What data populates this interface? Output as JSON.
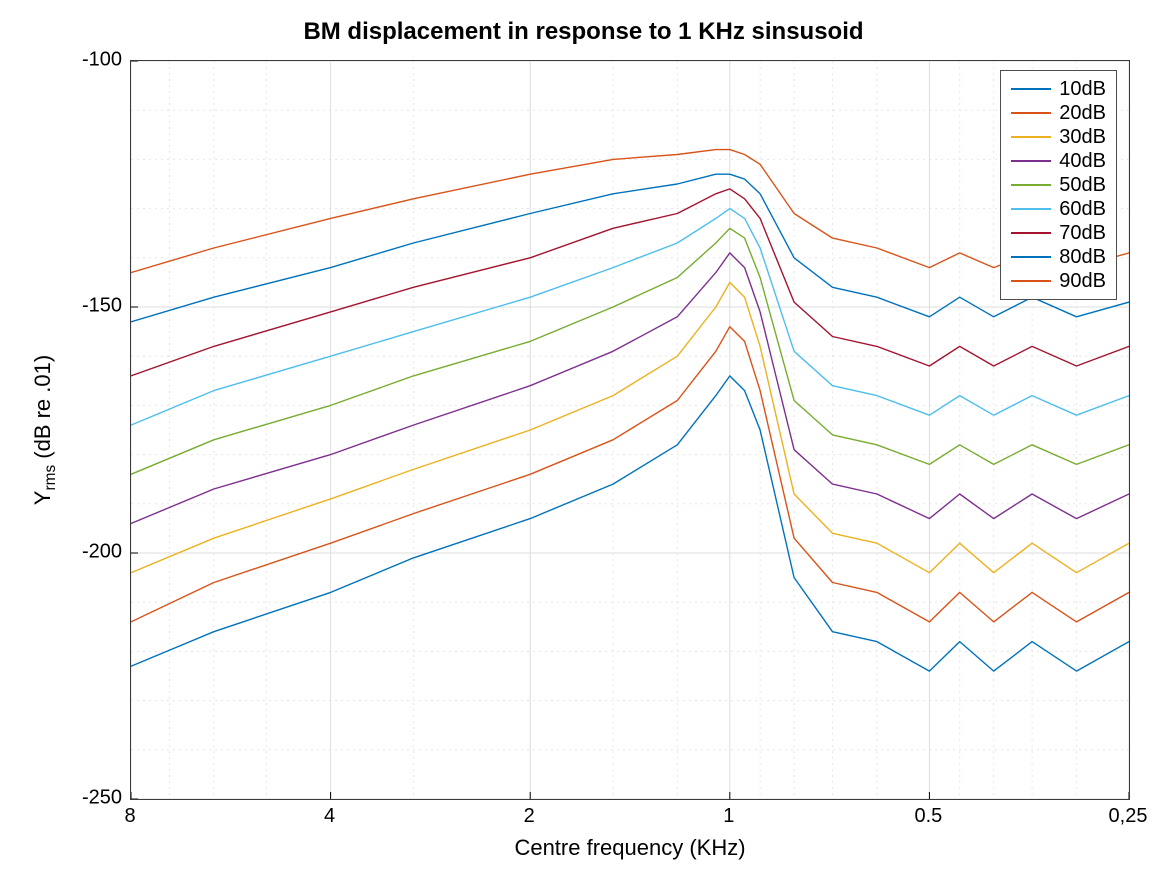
{
  "chart_data": {
    "type": "line",
    "title": "BM displacement in response to 1 KHz sinsusoid",
    "xlabel": "Centre frequency (KHz)",
    "ylabel_html": "Y<sub>rms</sub>  (dB re .01)",
    "x_axis": {
      "scale": "log",
      "reversed": true,
      "ticks": [
        8,
        4,
        2,
        1,
        0.5,
        0.25
      ],
      "tick_labels": [
        "8",
        "4",
        "2",
        "1",
        "0.5",
        "0,25"
      ],
      "range_khz": [
        8,
        0.25
      ]
    },
    "y_axis": {
      "ticks": [
        -100,
        -150,
        -200,
        -250
      ],
      "tick_labels": [
        "-100",
        "-150",
        "-200",
        "-250"
      ],
      "range": [
        -250,
        -100
      ]
    },
    "x_samples_khz": [
      8,
      6,
      4,
      3,
      2,
      1.5,
      1.2,
      1.05,
      1.0,
      0.95,
      0.9,
      0.8,
      0.7,
      0.6,
      0.5,
      0.45,
      0.4,
      0.35,
      0.3,
      0.25
    ],
    "series": [
      {
        "name": "10dB",
        "color": "#0072BD",
        "values": [
          -223,
          -216,
          -208,
          -201,
          -193,
          -186,
          -178,
          -168,
          -164,
          -167,
          -175,
          -205,
          -216,
          -218,
          -224,
          -218,
          -224,
          -218,
          -224,
          -218
        ]
      },
      {
        "name": "20dB",
        "color": "#D95319",
        "values": [
          -214,
          -206,
          -198,
          -192,
          -184,
          -177,
          -169,
          -159,
          -154,
          -157,
          -167,
          -197,
          -206,
          -208,
          -214,
          -208,
          -214,
          -208,
          -214,
          -208
        ]
      },
      {
        "name": "30dB",
        "color": "#EDB120",
        "values": [
          -204,
          -197,
          -189,
          -183,
          -175,
          -168,
          -160,
          -150,
          -145,
          -148,
          -158,
          -188,
          -196,
          -198,
          -204,
          -198,
          -204,
          -198,
          -204,
          -198
        ]
      },
      {
        "name": "40dB",
        "color": "#7E2F8E",
        "values": [
          -194,
          -187,
          -180,
          -174,
          -166,
          -159,
          -152,
          -143,
          -139,
          -142,
          -151,
          -179,
          -186,
          -188,
          -193,
          -188,
          -193,
          -188,
          -193,
          -188
        ]
      },
      {
        "name": "50dB",
        "color": "#77AC30",
        "values": [
          -184,
          -177,
          -170,
          -164,
          -157,
          -150,
          -144,
          -137,
          -134,
          -136,
          -144,
          -169,
          -176,
          -178,
          -182,
          -178,
          -182,
          -178,
          -182,
          -178
        ]
      },
      {
        "name": "60dB",
        "color": "#4DBEEE",
        "values": [
          -174,
          -167,
          -160,
          -155,
          -148,
          -142,
          -137,
          -132,
          -130,
          -132,
          -138,
          -159,
          -166,
          -168,
          -172,
          -168,
          -172,
          -168,
          -172,
          -168
        ]
      },
      {
        "name": "70dB",
        "color": "#A2142F",
        "values": [
          -164,
          -158,
          -151,
          -146,
          -140,
          -134,
          -131,
          -127,
          -126,
          -128,
          -132,
          -149,
          -156,
          -158,
          -162,
          -158,
          -162,
          -158,
          -162,
          -158
        ]
      },
      {
        "name": "80dB",
        "color": "#0072BD",
        "values": [
          -153,
          -148,
          -142,
          -137,
          -131,
          -127,
          -125,
          -123,
          -123,
          -124,
          -127,
          -140,
          -146,
          -148,
          -152,
          -148,
          -152,
          -148,
          -152,
          -149
        ]
      },
      {
        "name": "90dB",
        "color": "#D95319",
        "values": [
          -143,
          -138,
          -132,
          -128,
          -123,
          -120,
          -119,
          -118,
          -118,
          -119,
          -121,
          -131,
          -136,
          -138,
          -142,
          -139,
          -142,
          -139,
          -142,
          -139
        ]
      }
    ],
    "legend_position": "top-right",
    "grid": true
  }
}
